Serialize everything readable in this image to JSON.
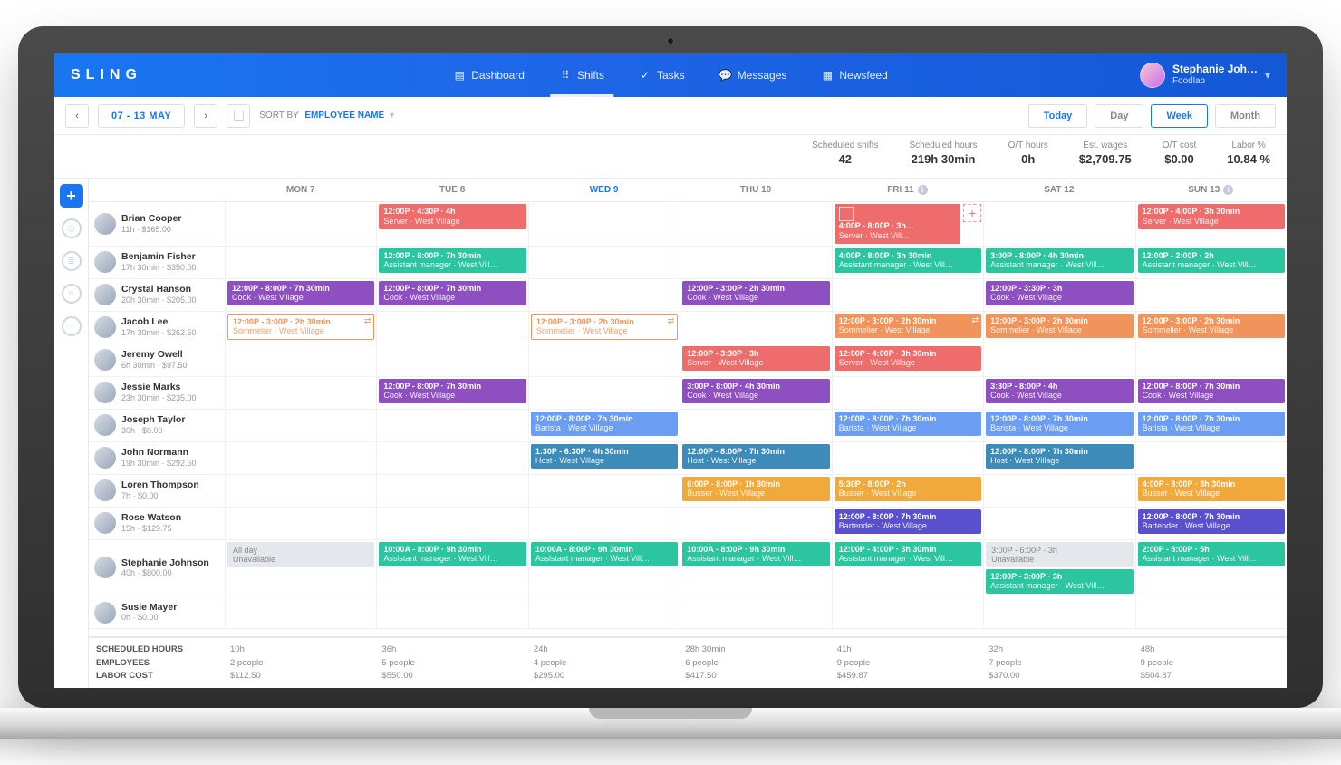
{
  "brand": "SLING",
  "nav": [
    {
      "label": "Dashboard",
      "icon": "dashboard"
    },
    {
      "label": "Shifts",
      "icon": "grid",
      "active": true
    },
    {
      "label": "Tasks",
      "icon": "check"
    },
    {
      "label": "Messages",
      "icon": "chat"
    },
    {
      "label": "Newsfeed",
      "icon": "feed"
    }
  ],
  "user": {
    "name": "Stephanie Joh…",
    "org": "Foodlab"
  },
  "date_range": "07 - 13 MAY",
  "sort": {
    "label": "SORT BY",
    "value": "EMPLOYEE NAME"
  },
  "view": {
    "today": "Today",
    "day": "Day",
    "week": "Week",
    "month": "Month",
    "active": "Week"
  },
  "stats": [
    {
      "label": "Scheduled shifts",
      "value": "42"
    },
    {
      "label": "Scheduled hours",
      "value": "219h 30min"
    },
    {
      "label": "O/T hours",
      "value": "0h"
    },
    {
      "label": "Est. wages",
      "value": "$2,709.75"
    },
    {
      "label": "O/T cost",
      "value": "$0.00"
    },
    {
      "label": "Labor %",
      "value": "10.84 %"
    }
  ],
  "columns": [
    {
      "label": "MON 7"
    },
    {
      "label": "TUE 8"
    },
    {
      "label": "WED 9",
      "current": true
    },
    {
      "label": "THU 10"
    },
    {
      "label": "FRI 11",
      "info": true
    },
    {
      "label": "SAT 12"
    },
    {
      "label": "SUN 13",
      "info": true
    }
  ],
  "colors": {
    "server": "#ef6c6c",
    "assistant": "#2bc6a0",
    "cook": "#8e4fc0",
    "sommelier": "#f0945b",
    "barista": "#6b9ef2",
    "host": "#3c8bb8",
    "busser": "#f2a93b",
    "bartender": "#5a4fcf",
    "gray": "#d7dce3",
    "unavail": "#e4e7ec"
  },
  "employees": [
    {
      "name": "Brian Cooper",
      "meta": "11h · $165.00",
      "shifts": [
        null,
        {
          "time": "12:00P · 4:30P · 4h",
          "role": "Server · West Village",
          "c": "server"
        },
        null,
        null,
        {
          "time": "4:00P - 8:00P · 3h…",
          "role": "Server · West Vill…",
          "c": "server",
          "pending": true,
          "addbtn": true
        },
        null,
        {
          "time": "12:00P - 4:00P · 3h 30min",
          "role": "Server · West Village",
          "c": "server"
        }
      ]
    },
    {
      "name": "Benjamin Fisher",
      "meta": "17h 30min · $350.00",
      "shifts": [
        null,
        {
          "time": "12:00P - 8:00P · 7h 30min",
          "role": "Assistant manager · West Vill…",
          "c": "assistant"
        },
        null,
        null,
        {
          "time": "4:00P - 8:00P · 3h 30min",
          "role": "Assistant manager · West Vill…",
          "c": "assistant"
        },
        {
          "time": "3:00P - 8:00P · 4h 30min",
          "role": "Assistant manager · West Vill…",
          "c": "assistant"
        },
        {
          "time": "12:00P - 2:00P · 2h",
          "role": "Assistant manager · West Vill…",
          "c": "assistant"
        }
      ]
    },
    {
      "name": "Crystal Hanson",
      "meta": "20h 30min · $205.00",
      "shifts": [
        {
          "time": "12:00P - 8:00P · 7h 30min",
          "role": "Cook · West Village",
          "c": "cook"
        },
        {
          "time": "12:00P - 8:00P · 7h 30min",
          "role": "Cook · West Village",
          "c": "cook"
        },
        null,
        {
          "time": "12:00P - 3:00P · 2h 30min",
          "role": "Cook · West Village",
          "c": "cook"
        },
        null,
        {
          "time": "12:00P - 3:30P · 3h",
          "role": "Cook · West Village",
          "c": "cook"
        },
        null
      ]
    },
    {
      "name": "Jacob Lee",
      "meta": "17h 30min · $262.50",
      "shifts": [
        {
          "time": "12:00P - 3:00P · 2h 30min",
          "role": "Sommelier · West Village",
          "c": "sommelier",
          "outline": true,
          "swap": true
        },
        null,
        {
          "time": "12:00P - 3:00P · 2h 30min",
          "role": "Sommelier · West Village",
          "c": "sommelier",
          "outline": true,
          "swap": true
        },
        null,
        {
          "time": "12:00P - 3:00P · 2h 30min",
          "role": "Sommelier · West Village",
          "c": "sommelier",
          "swap": true
        },
        {
          "time": "12:00P - 3:00P · 2h 30min",
          "role": "Sommelier · West Village",
          "c": "sommelier"
        },
        {
          "time": "12:00P - 3:00P · 2h 30min",
          "role": "Sommelier · West Village",
          "c": "sommelier"
        }
      ]
    },
    {
      "name": "Jeremy Owell",
      "meta": "6h 30min · $97.50",
      "shifts": [
        null,
        null,
        null,
        {
          "time": "12:00P - 3:30P · 3h",
          "role": "Server · West Village",
          "c": "server"
        },
        {
          "time": "12:00P - 4:00P · 3h 30min",
          "role": "Server · West Village",
          "c": "server"
        },
        null,
        null
      ]
    },
    {
      "name": "Jessie Marks",
      "meta": "23h 30min · $235.00",
      "shifts": [
        null,
        {
          "time": "12:00P - 8:00P · 7h 30min",
          "role": "Cook · West Village",
          "c": "cook"
        },
        null,
        {
          "time": "3:00P - 8:00P · 4h 30min",
          "role": "Cook · West Village",
          "c": "cook"
        },
        null,
        {
          "time": "3:30P - 8:00P · 4h",
          "role": "Cook · West Village",
          "c": "cook"
        },
        {
          "time": "12:00P - 8:00P · 7h 30min",
          "role": "Cook · West Village",
          "c": "cook"
        }
      ]
    },
    {
      "name": "Joseph Taylor",
      "meta": "30h · $0.00",
      "shifts": [
        null,
        null,
        {
          "time": "12:00P - 8:00P · 7h 30min",
          "role": "Barista · West Village",
          "c": "barista"
        },
        null,
        {
          "time": "12:00P - 8:00P · 7h 30min",
          "role": "Barista · West Village",
          "c": "barista"
        },
        {
          "time": "12:00P - 8:00P · 7h 30min",
          "role": "Barista · West Village",
          "c": "barista"
        },
        {
          "time": "12:00P - 8:00P · 7h 30min",
          "role": "Barista · West Village",
          "c": "barista"
        }
      ]
    },
    {
      "name": "John Normann",
      "meta": "19h 30min · $292.50",
      "shifts": [
        null,
        null,
        {
          "time": "1:30P - 6:30P · 4h 30min",
          "role": "Host · West Village",
          "c": "host"
        },
        {
          "time": "12:00P - 8:00P · 7h 30min",
          "role": "Host · West Village",
          "c": "host"
        },
        null,
        {
          "time": "12:00P - 8:00P · 7h 30min",
          "role": "Host · West Village",
          "c": "host"
        },
        null
      ]
    },
    {
      "name": "Loren Thompson",
      "meta": "7h · $0.00",
      "shifts": [
        null,
        null,
        null,
        {
          "time": "6:00P - 8:00P · 1h 30min",
          "role": "Busser · West Village",
          "c": "busser"
        },
        {
          "time": "5:30P - 8:00P · 2h",
          "role": "Busser · West Village",
          "c": "busser"
        },
        null,
        {
          "time": "4:00P - 8:00P · 3h 30min",
          "role": "Busser · West Village",
          "c": "busser"
        }
      ]
    },
    {
      "name": "Rose Watson",
      "meta": "15h · $129.75",
      "shifts": [
        null,
        null,
        null,
        null,
        {
          "time": "12:00P - 8:00P · 7h 30min",
          "role": "Bartender · West Village",
          "c": "bartender"
        },
        null,
        {
          "time": "12:00P - 8:00P · 7h 30min",
          "role": "Bartender · West Village",
          "c": "bartender"
        }
      ]
    },
    {
      "name": "Stephanie Johnson",
      "meta": "40h · $800.00",
      "shifts": [
        {
          "unavail": true,
          "time": "All day",
          "role": "Unavailable"
        },
        {
          "time": "10:00A - 8:00P · 9h 30min",
          "role": "Assistant manager · West Vill…",
          "c": "assistant"
        },
        {
          "time": "10:00A - 8:00P · 9h 30min",
          "role": "Assistant manager · West Vill…",
          "c": "assistant"
        },
        {
          "time": "10:00A - 8:00P · 9h 30min",
          "role": "Assistant manager · West Vill…",
          "c": "assistant"
        },
        {
          "time": "12:00P - 4:00P · 3h 30min",
          "role": "Assistant manager · West Vill…",
          "c": "assistant"
        },
        [
          {
            "unavail": true,
            "time": "3:00P - 6:00P · 3h",
            "role": "Unavailable"
          },
          {
            "time": "12:00P - 3:00P · 3h",
            "role": "Assistant manager · West Vill…",
            "c": "assistant"
          }
        ],
        {
          "time": "2:00P - 8:00P · 5h",
          "role": "Assistant manager · West Vill…",
          "c": "assistant"
        }
      ]
    },
    {
      "name": "Susie Mayer",
      "meta": "0h · $0.00",
      "shifts": [
        null,
        null,
        null,
        null,
        null,
        null,
        null
      ]
    }
  ],
  "footer": {
    "labels": [
      "Scheduled Hours",
      "Employees",
      "Labor Cost"
    ],
    "cells": [
      {
        "h": "10h",
        "e": "2 people",
        "c": "$112.50"
      },
      {
        "h": "36h",
        "e": "5 people",
        "c": "$550.00"
      },
      {
        "h": "24h",
        "e": "4 people",
        "c": "$295.00"
      },
      {
        "h": "28h 30min",
        "e": "6 people",
        "c": "$417.50"
      },
      {
        "h": "41h",
        "e": "9 people",
        "c": "$459.87"
      },
      {
        "h": "32h",
        "e": "7 people",
        "c": "$370.00"
      },
      {
        "h": "48h",
        "e": "9 people",
        "c": "$504.87"
      }
    ]
  }
}
